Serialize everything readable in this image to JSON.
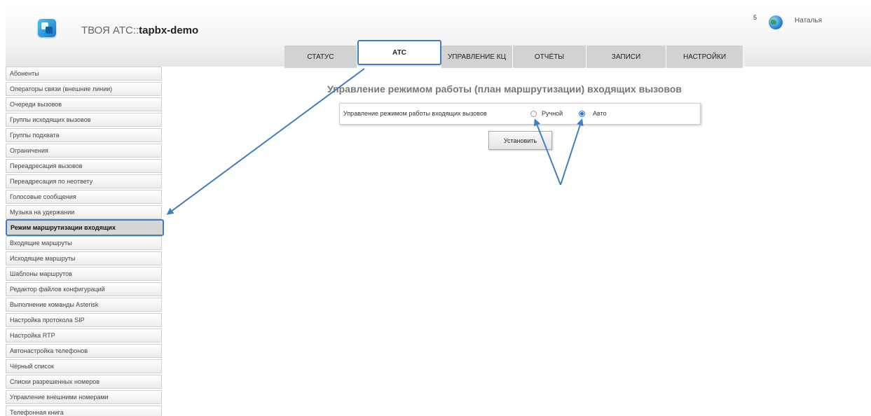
{
  "header": {
    "app_name": "ТВОЯ АТС::",
    "site_name": "tapbx-demo",
    "user_count": "5",
    "user_name": "Наталья"
  },
  "tabs": [
    {
      "label": "СТАТУС"
    },
    {
      "label": "АТС",
      "active": true
    },
    {
      "label": "УПРАВЛЕНИЕ КЦ"
    },
    {
      "label": "ОТЧЁТЫ"
    },
    {
      "label": "ЗАПИСИ"
    },
    {
      "label": "НАСТРОЙКИ"
    }
  ],
  "sidebar": {
    "items": [
      {
        "label": "Абоненты"
      },
      {
        "label": "Операторы связи (внешние линии)"
      },
      {
        "label": "Очереди вызовов"
      },
      {
        "label": "Группы исходящих вызовов"
      },
      {
        "label": "Группы подхвата"
      },
      {
        "label": "Ограничения"
      },
      {
        "label": "Переадресация вызовов"
      },
      {
        "label": "Переадресация по неответу"
      },
      {
        "label": "Голосовые сообщения"
      },
      {
        "label": "Музыка на удержании"
      },
      {
        "label": "Режим маршрутизации входящих",
        "active": true
      },
      {
        "label": "Входящие маршруты"
      },
      {
        "label": "Исходящие маршруты"
      },
      {
        "label": "Шаблоны маршрутов"
      },
      {
        "label": "Редактор файлов конфигураций"
      },
      {
        "label": "Выполнение команды Asterisk"
      },
      {
        "label": "Настройка протокола SIP"
      },
      {
        "label": "Настройка RTP"
      },
      {
        "label": "Автонастройка телефонов"
      },
      {
        "label": "Чёрный список"
      },
      {
        "label": "Списки разрешенных номеров"
      },
      {
        "label": "Управление внешними номерами"
      },
      {
        "label": "Телефонная книга"
      }
    ]
  },
  "main": {
    "title": "Управление режимом работы (план маршрутизации) входящих вызовов",
    "mode_label": "Управление режимом работы входящих вызовов",
    "options": [
      {
        "label": "Ручной",
        "checked": false
      },
      {
        "label": "Авто",
        "checked": true
      }
    ],
    "submit_label": "Установить"
  },
  "colors": {
    "accent": "#3f7fc1",
    "tab_bg": "#d2d2d2",
    "radio_checked": "#2a6fd6"
  }
}
